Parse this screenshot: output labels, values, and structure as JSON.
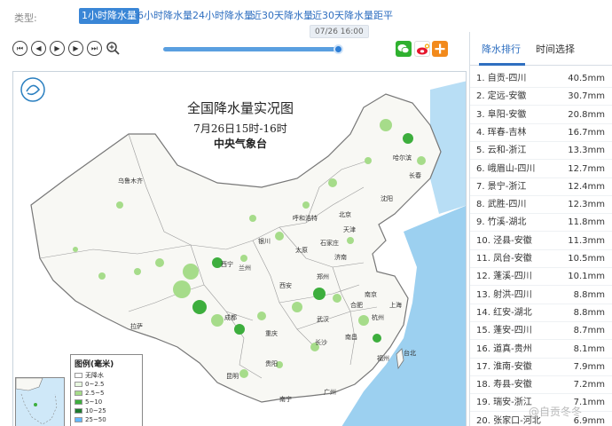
{
  "typebar": {
    "label": "类型:",
    "tabs": [
      "1小时降水量",
      "6小时降水量",
      "24小时降水量",
      "近30天降水量",
      "近30天降水量距平"
    ],
    "active_index": 0
  },
  "player": {
    "controls": [
      "first-icon",
      "prev-icon",
      "play-icon",
      "next-icon",
      "last-icon",
      "zoom-icon"
    ],
    "time_tooltip": "07/26 16:00",
    "progress": 1.0
  },
  "share_icons": [
    "wechat-icon",
    "weibo-icon",
    "plus-icon"
  ],
  "map": {
    "title": "全国降水量实况图",
    "subtitle": "7月26日15时-16时",
    "source": "中央气象台",
    "cities": [
      "乌鲁木齐",
      "哈尔滨",
      "长春",
      "沈阳",
      "呼和浩特",
      "北京",
      "天津",
      "银川",
      "石家庄",
      "太原",
      "济南",
      "西宁",
      "兰州",
      "郑州",
      "西安",
      "南京",
      "合肥",
      "上海",
      "成都",
      "武汉",
      "杭州",
      "重庆",
      "长沙",
      "南昌",
      "拉萨",
      "贵阳",
      "福州",
      "昆明",
      "广州",
      "南宁",
      "台北"
    ],
    "legend": {
      "title": "图例(毫米)",
      "items": [
        {
          "label": "无降水",
          "color": "#ffffff"
        },
        {
          "label": "0~2.5",
          "color": "#e8f7e0"
        },
        {
          "label": "2.5~5",
          "color": "#a6dc8a"
        },
        {
          "label": "5~10",
          "color": "#3dae3d"
        },
        {
          "label": "10~25",
          "color": "#1e7a2e"
        },
        {
          "label": "25~50",
          "color": "#63b8ff"
        }
      ]
    },
    "colors": {
      "land": "#f8f8f4",
      "border": "#777777",
      "sea": "#9cd0f0",
      "rain_light": "#a6dc8a",
      "rain_mid": "#3dae3d"
    }
  },
  "ranking": {
    "tabs": [
      "降水排行",
      "时间选择"
    ],
    "active_index": 0,
    "rows": [
      {
        "name": "1. 自贡-四川",
        "value": "40.5mm"
      },
      {
        "name": "2. 定远-安徽",
        "value": "30.7mm"
      },
      {
        "name": "3. 阜阳-安徽",
        "value": "20.8mm"
      },
      {
        "name": "4. 珲春-吉林",
        "value": "16.7mm"
      },
      {
        "name": "5. 云和-浙江",
        "value": "13.3mm"
      },
      {
        "name": "6. 峨眉山-四川",
        "value": "12.7mm"
      },
      {
        "name": "7. 景宁-浙江",
        "value": "12.4mm"
      },
      {
        "name": "8. 武胜-四川",
        "value": "12.3mm"
      },
      {
        "name": "9. 竹溪-湖北",
        "value": "11.8mm"
      },
      {
        "name": "10. 泾县-安徽",
        "value": "11.3mm"
      },
      {
        "name": "11. 凤台-安徽",
        "value": "10.5mm"
      },
      {
        "name": "12. 蓬溪-四川",
        "value": "10.1mm"
      },
      {
        "name": "13. 射洪-四川",
        "value": "8.8mm"
      },
      {
        "name": "14. 红安-湖北",
        "value": "8.8mm"
      },
      {
        "name": "15. 蓬安-四川",
        "value": "8.7mm"
      },
      {
        "name": "16. 道真-贵州",
        "value": "8.1mm"
      },
      {
        "name": "17. 淮南-安徽",
        "value": "7.9mm"
      },
      {
        "name": "18. 寿县-安徽",
        "value": "7.2mm"
      },
      {
        "name": "19. 瑞安-浙江",
        "value": "7.1mm"
      },
      {
        "name": "20. 张家口-河北",
        "value": "6.9mm"
      }
    ]
  },
  "watermark": "@自贡冬冬"
}
